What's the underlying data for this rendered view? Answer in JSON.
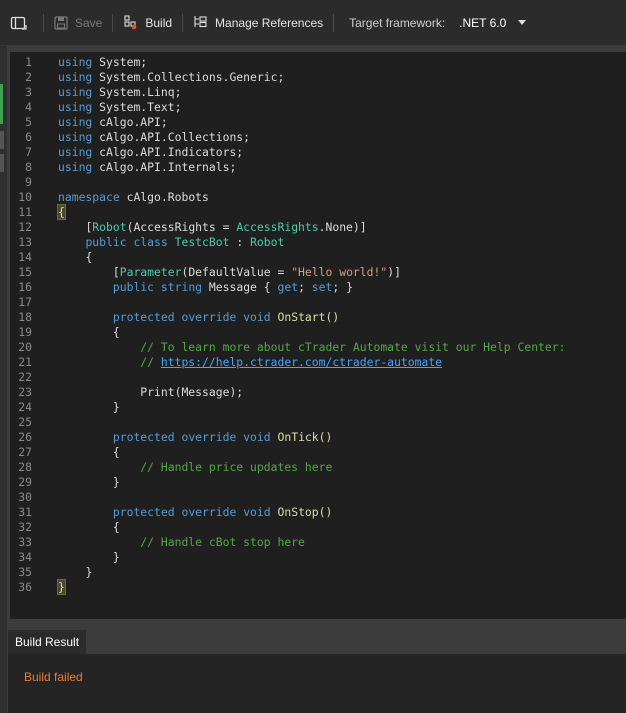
{
  "toolbar": {
    "save_label": "Save",
    "build_label": "Build",
    "manage_references_label": "Manage References",
    "target_framework_label": "Target framework:",
    "target_framework_value": ".NET 6.0"
  },
  "editor": {
    "line_numbers": [
      "1",
      "2",
      "3",
      "4",
      "5",
      "6",
      "7",
      "8",
      "9",
      "10",
      "11",
      "12",
      "13",
      "14",
      "15",
      "16",
      "17",
      "18",
      "19",
      "20",
      "21",
      "22",
      "23",
      "24",
      "25",
      "26",
      "27",
      "28",
      "29",
      "30",
      "31",
      "32",
      "33",
      "34",
      "35",
      "36"
    ],
    "tokens": {
      "using": "using",
      "system": "System;",
      "collections_generic": "System.Collections.Generic;",
      "linq": "System.Linq;",
      "text": "System.Text;",
      "calgo_api": "cAlgo.API;",
      "calgo_api_collections": "cAlgo.API.Collections;",
      "calgo_api_indicators": "cAlgo.API.Indicators;",
      "calgo_api_internals": "cAlgo.API.Internals;",
      "namespace": "namespace",
      "namespace_name": "cAlgo.Robots",
      "open_brace": "{",
      "close_brace": "}",
      "robot_attr_open": "[",
      "robot_attr": "Robot",
      "robot_attr_rest": "(AccessRights = ",
      "access_rights_type": "AccessRights",
      "robot_attr_end": ".None)]",
      "public": "public",
      "class": "class",
      "class_name": "TestcBot",
      "colon": " : ",
      "base_class": "Robot",
      "param_open": "[",
      "parameter_attr": "Parameter",
      "param_mid": "(DefaultValue = ",
      "param_string": "\"Hello world!\"",
      "param_end": ")]",
      "string_kw": "string",
      "message_prop": "Message { ",
      "get_kw": "get",
      "semi_space": "; ",
      "set_kw": "set",
      "prop_end": "; }",
      "protected": "protected",
      "override": "override",
      "void": "void",
      "on_start": "OnStart()",
      "comment_help": "// To learn more about cTrader Automate visit our Help Center:",
      "comment_slashes": "// ",
      "help_link": "https://help.ctrader.com/ctrader-automate",
      "print_call": "Print(Message);",
      "on_tick": "OnTick()",
      "comment_tick": "// Handle price updates here",
      "on_stop": "OnStop()",
      "comment_stop": "// Handle cBot stop here"
    }
  },
  "bottom_panel": {
    "tab_label": "Build Result",
    "status_text": "Build failed"
  },
  "colors": {
    "keyword": "#569cd6",
    "type": "#4ec9b0",
    "string": "#d69d85",
    "comment": "#57a64a",
    "error": "#f07a32"
  }
}
